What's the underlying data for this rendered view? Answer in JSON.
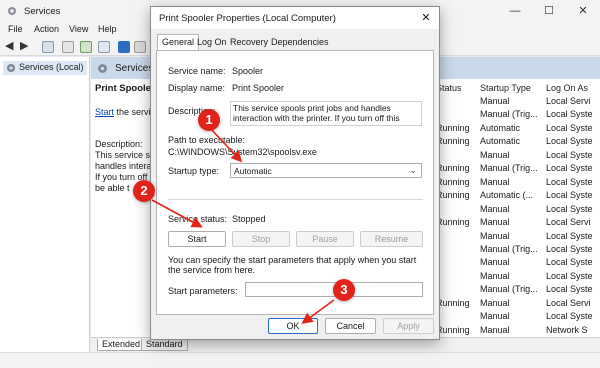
{
  "window": {
    "title": "Services"
  },
  "menu": [
    "File",
    "Action",
    "View",
    "Help"
  ],
  "tree": {
    "selected": "Services (Local)"
  },
  "content_header": "Services (",
  "description_pane": {
    "title": "Print Spooler",
    "start_link": "Start",
    "start_suffix": " the service",
    "desc_label": "Description:",
    "lines": [
      "This service spo",
      "handles interac",
      "If you turn off t",
      "be able t"
    ]
  },
  "columns": {
    "status": "Status",
    "startup": "Startup Type",
    "logon": "Log On As"
  },
  "rows": [
    {
      "status": "",
      "startup": "Manual",
      "logon": "Local Servi"
    },
    {
      "status": "",
      "startup": "Manual (Trig...",
      "logon": "Local Syste"
    },
    {
      "status": "Running",
      "startup": "Automatic",
      "logon": "Local Syste"
    },
    {
      "status": "Running",
      "startup": "Automatic",
      "logon": "Local Syste"
    },
    {
      "status": "",
      "startup": "Manual",
      "logon": "Local Syste"
    },
    {
      "status": "Running",
      "startup": "Manual (Trig...",
      "logon": "Local Syste"
    },
    {
      "status": "Running",
      "startup": "Manual",
      "logon": "Local Syste"
    },
    {
      "status": "Running",
      "startup": "Automatic (...",
      "logon": "Local Syste"
    },
    {
      "status": "",
      "startup": "Manual",
      "logon": "Local Syste"
    },
    {
      "status": "Running",
      "startup": "Manual",
      "logon": "Local Servi"
    },
    {
      "status": "",
      "startup": "Manual",
      "logon": "Local Syste"
    },
    {
      "status": "",
      "startup": "Manual (Trig...",
      "logon": "Local Syste"
    },
    {
      "status": "",
      "startup": "Manual",
      "logon": "Local Syste"
    },
    {
      "status": "",
      "startup": "Manual",
      "logon": "Local Syste"
    },
    {
      "status": "",
      "startup": "Manual (Trig...",
      "logon": "Local Syste"
    },
    {
      "status": "Running",
      "startup": "Manual",
      "logon": "Local Servi"
    },
    {
      "status": "",
      "startup": "Manual",
      "logon": "Local Syste"
    },
    {
      "status": "Running",
      "startup": "Manual",
      "logon": "Network S"
    },
    {
      "status": "",
      "startup": "Manual",
      "logon": "Local Syste"
    }
  ],
  "bottom_tabs": [
    "Extended",
    "Standard"
  ],
  "dialog": {
    "title": "Print Spooler Properties (Local Computer)",
    "close": "✕",
    "tabs": [
      "General",
      "Log On",
      "Recovery",
      "Dependencies"
    ],
    "service_name_label": "Service name:",
    "service_name": "Spooler",
    "display_name_label": "Display name:",
    "display_name": "Print Spooler",
    "description_label": "Description:",
    "description": "This service spools print jobs and handles interaction with the printer.  If you turn off this service, you won't be able to print or see your printers.",
    "path_label": "Path to executable:",
    "path": "C:\\WINDOWS\\System32\\spoolsv.exe",
    "startup_type_label": "Startup type:",
    "startup_type": "Automatic",
    "service_status_label": "Service status:",
    "service_status": "Stopped",
    "buttons": {
      "start": "Start",
      "stop": "Stop",
      "pause": "Pause",
      "resume": "Resume"
    },
    "hint": "You can specify the start parameters that apply when you start the service from here.",
    "start_params_label": "Start parameters:",
    "ok": "OK",
    "cancel": "Cancel",
    "apply": "Apply"
  },
  "annotations": [
    "1",
    "2",
    "3"
  ],
  "colors": {
    "badge": "#e2231a",
    "selection": "#dce8f5",
    "header": "#c9d9ea"
  }
}
